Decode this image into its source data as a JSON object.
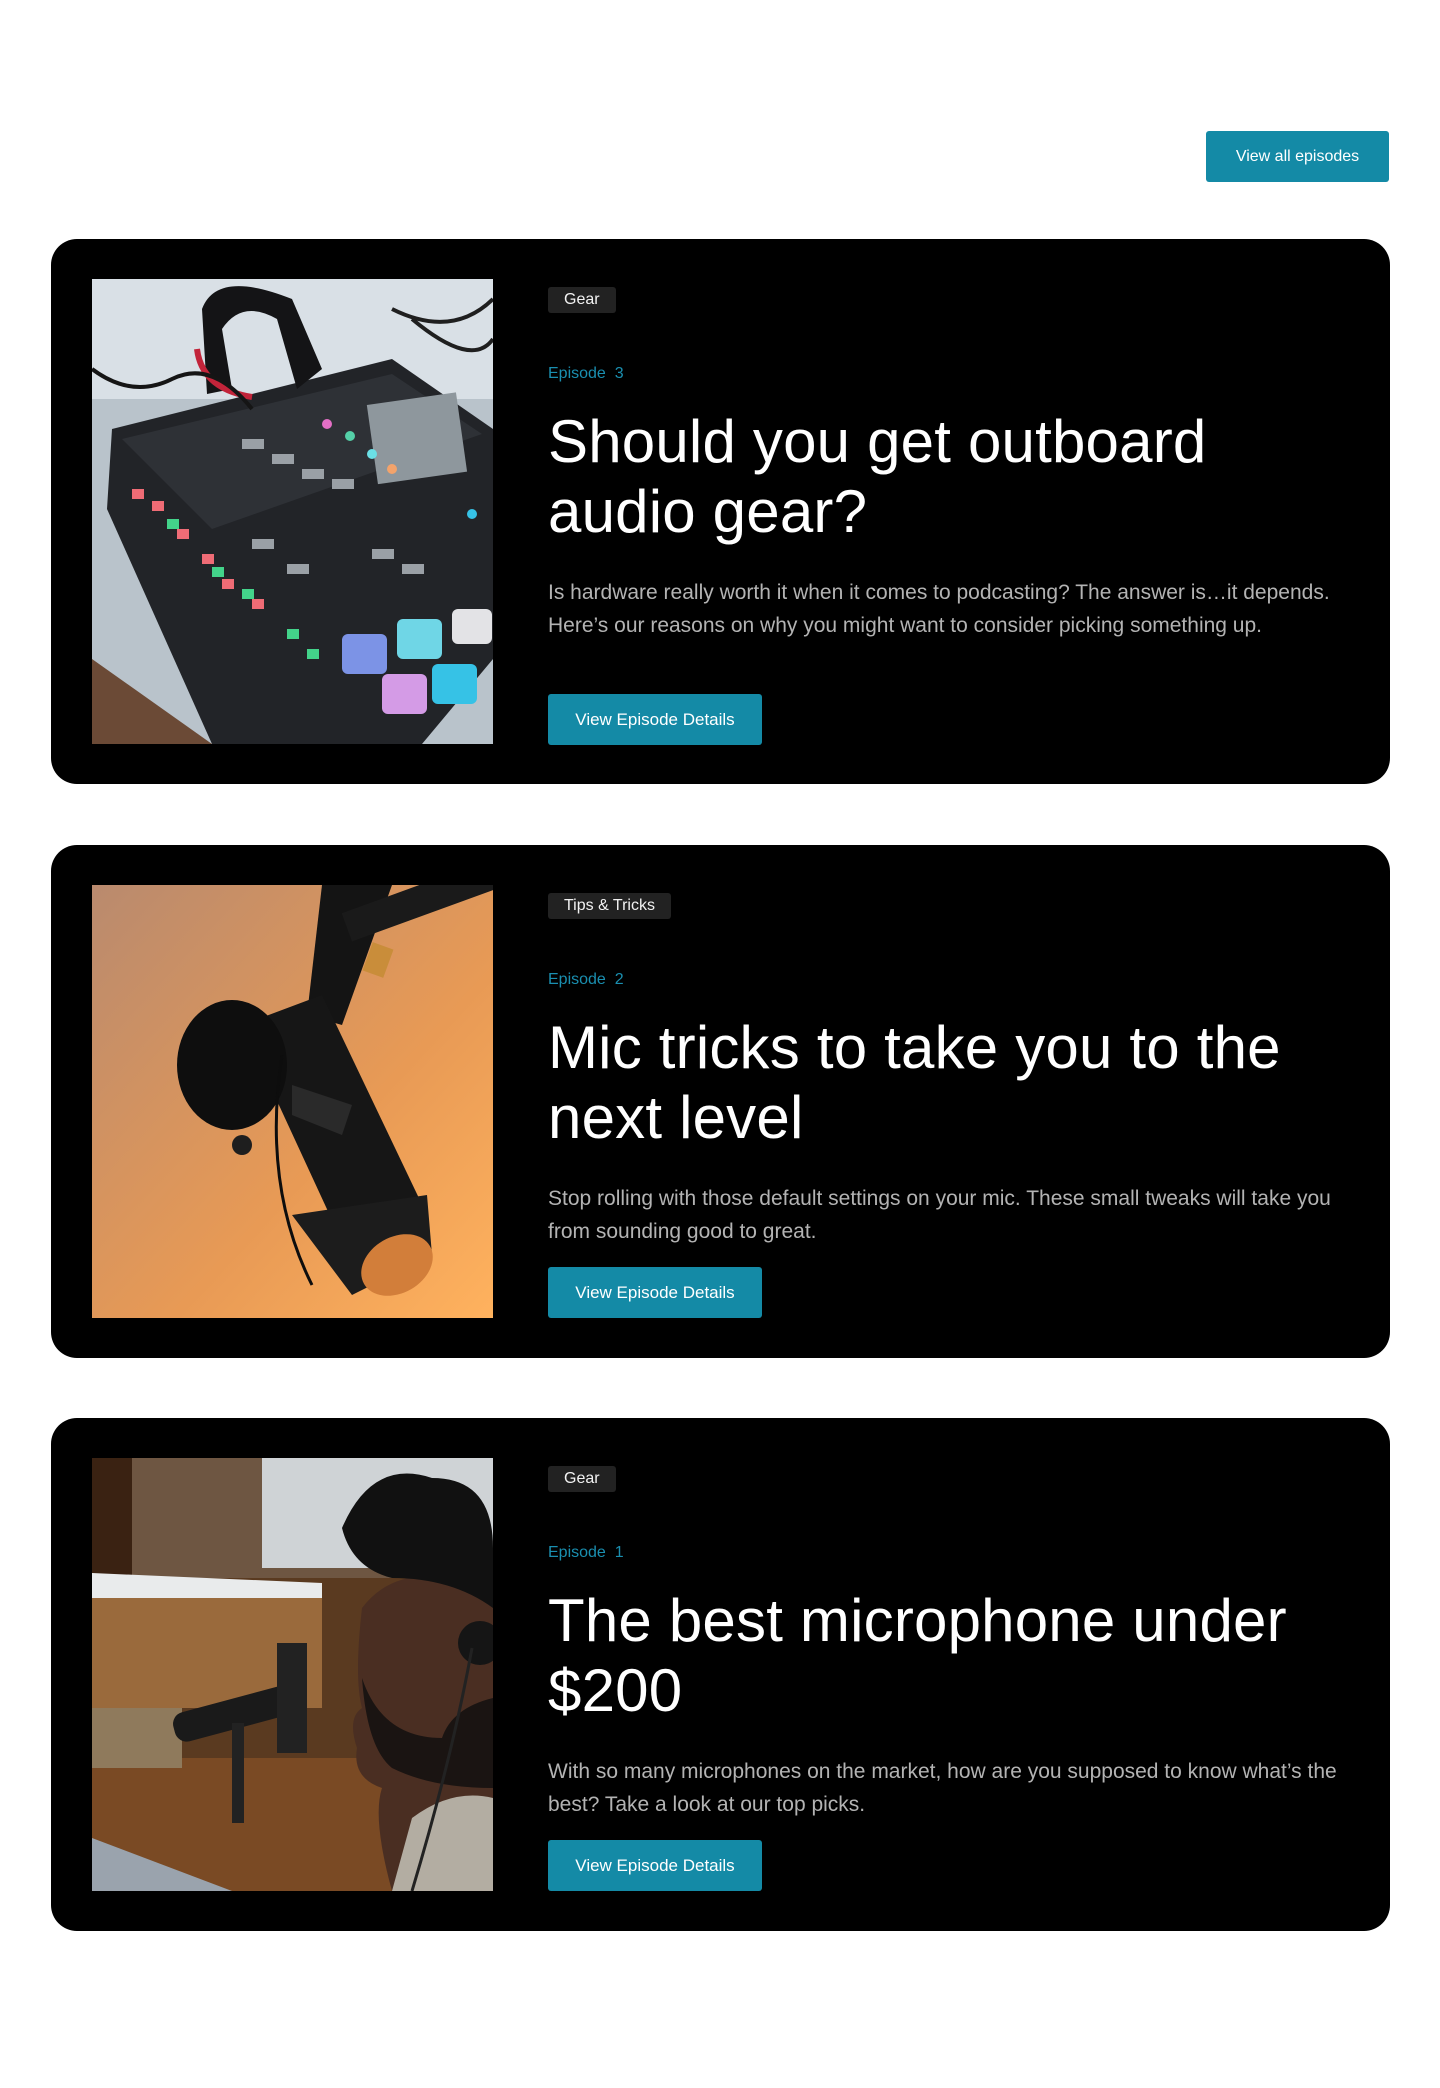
{
  "header": {
    "view_all_label": "View all episodes"
  },
  "episodes": [
    {
      "tag": "Gear",
      "episode_label": "Episode  3",
      "title": "Should you get outboard audio gear?",
      "description": "Is hardware really worth it when it comes to podcasting? The answer is…it depends. Here’s our reasons on why you might want to consider picking something up.",
      "button_label": "View Episode Details",
      "image_subject": "audio-mixer-image"
    },
    {
      "tag": "Tips & Tricks",
      "episode_label": "Episode  2",
      "title": "Mic tricks to take you to the next level",
      "description": "Stop rolling with those default settings on your mic. These small tweaks will take you from sounding good to great.",
      "button_label": "View Episode Details",
      "image_subject": "microphone-image"
    },
    {
      "tag": "Gear",
      "episode_label": "Episode  1",
      "title": "The best microphone under $200",
      "description": "With so many microphones on the market, how are you supposed to know what’s the best? Take a look at our top picks.",
      "button_label": "View Episode Details",
      "image_subject": "podcaster-image"
    }
  ],
  "colors": {
    "accent": "#148aa6",
    "episode_text": "#1a8fb0",
    "card_bg": "#000000",
    "tag_bg": "#222222"
  }
}
